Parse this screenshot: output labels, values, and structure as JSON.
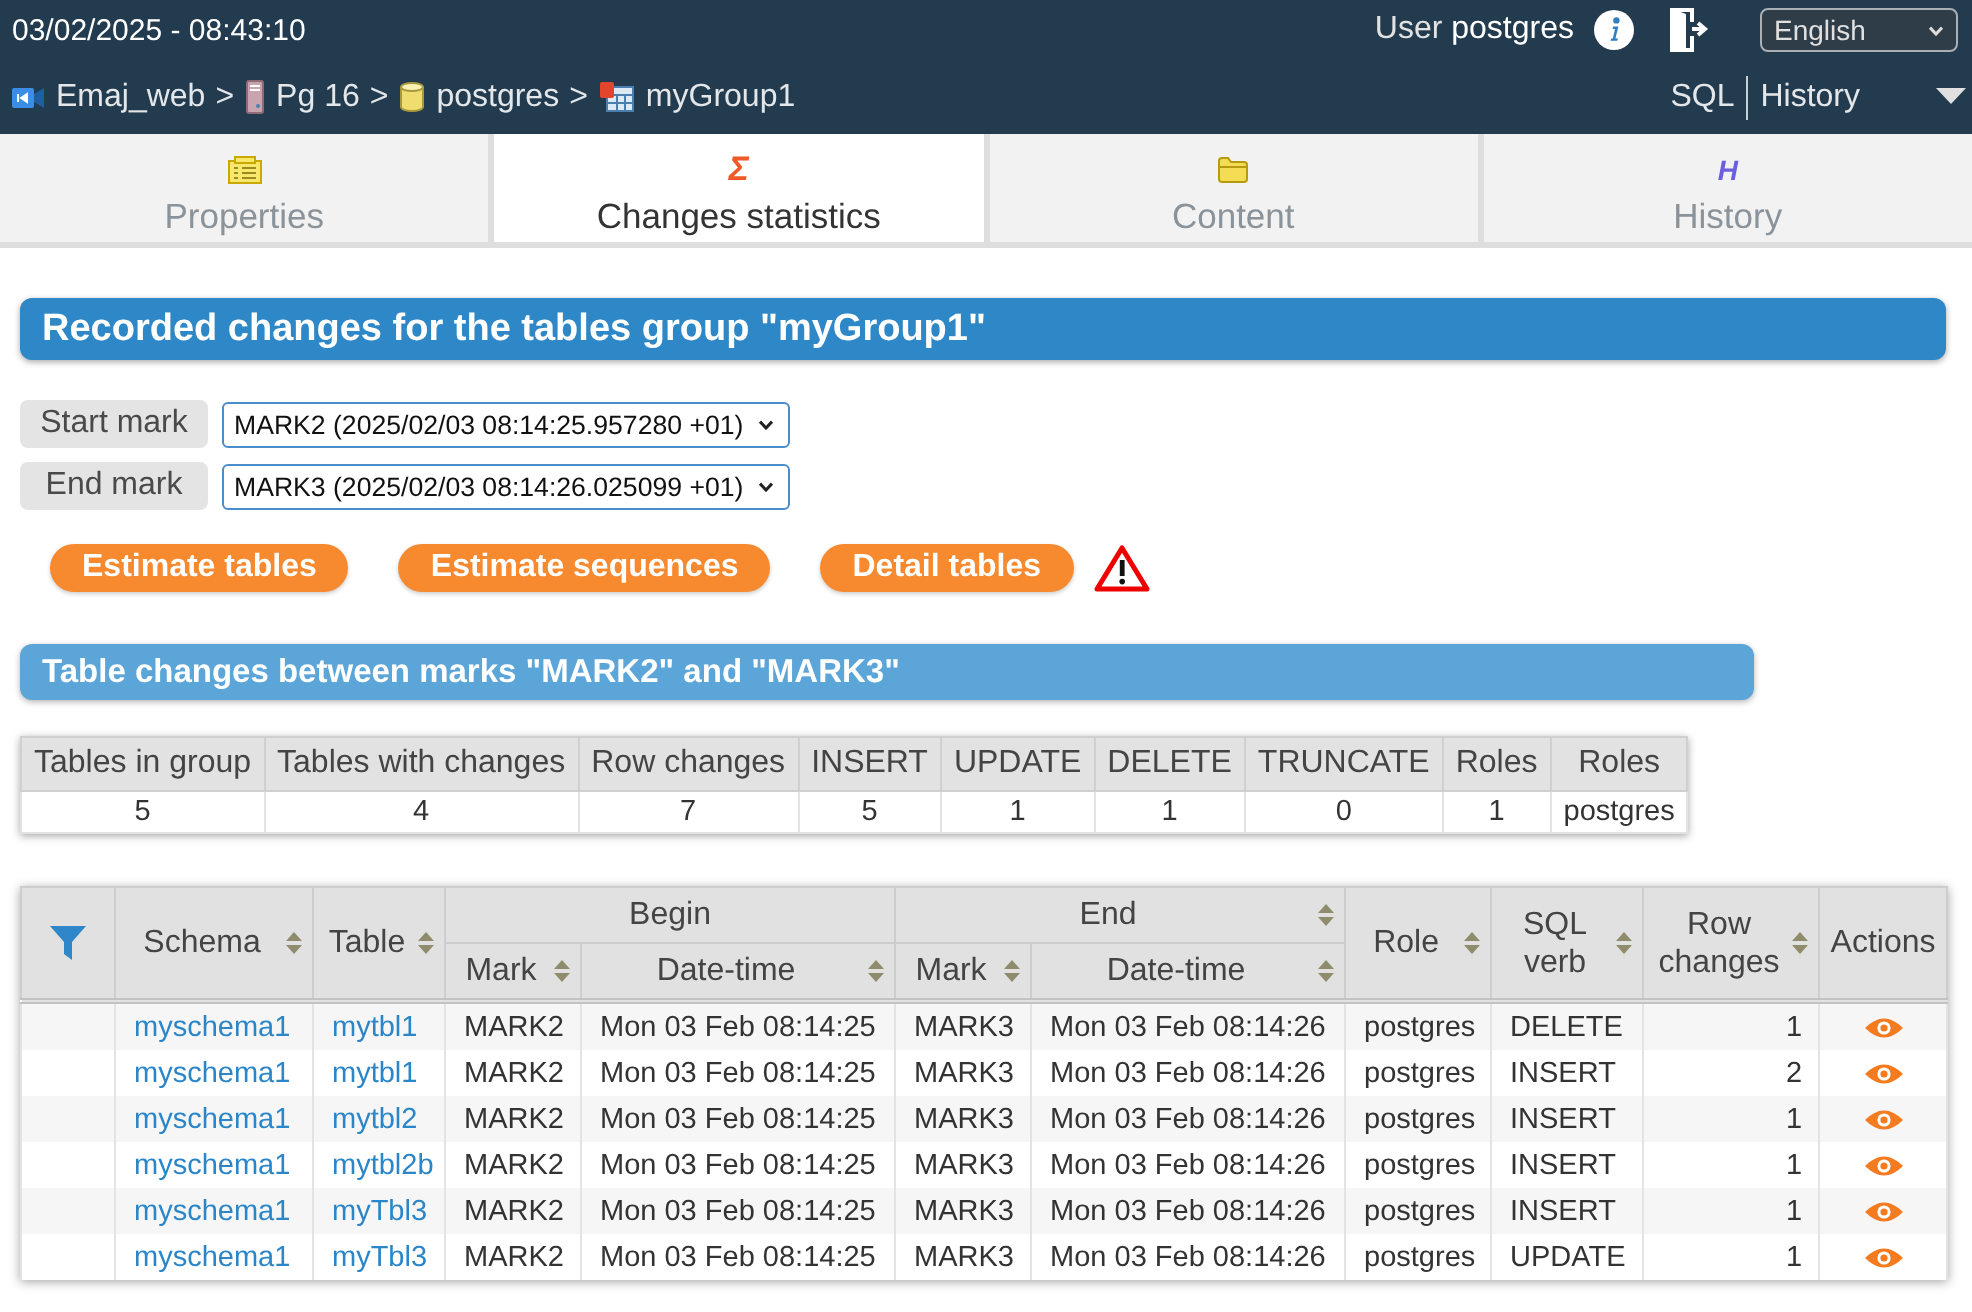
{
  "header": {
    "datetime": "03/02/2025 - 08:43:10",
    "user_label": "User",
    "user_name": "postgres",
    "language": "English"
  },
  "breadcrumbs": [
    {
      "kind": "app",
      "label": "Emaj_web",
      "separator": ">"
    },
    {
      "kind": "server",
      "label": "Pg 16",
      "separator": ">"
    },
    {
      "kind": "database",
      "label": "postgres",
      "separator": ">"
    },
    {
      "kind": "group",
      "label": "myGroup1"
    }
  ],
  "top_links": [
    "SQL",
    "History"
  ],
  "tabs": [
    {
      "kind": "properties",
      "label": "Properties",
      "selected": false
    },
    {
      "kind": "statistics",
      "glyph": "Σ",
      "label": "Changes statistics",
      "selected": true
    },
    {
      "kind": "content",
      "label": "Content",
      "selected": false
    },
    {
      "kind": "history",
      "glyph": "H",
      "label": "History",
      "selected": false
    }
  ],
  "page_title": "Recorded changes for the tables group \"myGroup1\"",
  "mark_selectors": [
    {
      "label": "Start mark",
      "value": "MARK2 (2025/02/03 08:14:25.957280 +01)"
    },
    {
      "label": "End mark",
      "value": "MARK3 (2025/02/03 08:14:26.025099 +01)"
    }
  ],
  "buttons": [
    "Estimate tables",
    "Estimate sequences",
    "Detail tables"
  ],
  "section_title": "Table changes between marks \"MARK2\" and \"MARK3\"",
  "summary": {
    "columns": [
      "Tables in group",
      "Tables with changes",
      "Row changes",
      "INSERT",
      "UPDATE",
      "DELETE",
      "TRUNCATE",
      "Roles",
      "Roles"
    ],
    "values": [
      "5",
      "4",
      "7",
      "5",
      "1",
      "1",
      "0",
      "1",
      "postgres"
    ]
  },
  "changes_table": {
    "columns": [
      {
        "label": "Schema",
        "sortable": true
      },
      {
        "label": "Table",
        "sortable": true
      },
      {
        "label": "Begin",
        "sortable": false,
        "children": [
          {
            "label": "Mark",
            "sortable": true
          },
          {
            "label": "Date-time",
            "sortable": true
          }
        ]
      },
      {
        "label": "End",
        "sortable": true,
        "children": [
          {
            "label": "Mark",
            "sortable": true
          },
          {
            "label": "Date-time",
            "sortable": true
          }
        ]
      },
      {
        "label": "Role",
        "sortable": true
      },
      {
        "label": "SQL verb",
        "sortable": true
      },
      {
        "label": "Row changes",
        "sortable": true
      },
      {
        "label": "Actions",
        "sortable": false
      }
    ],
    "rows": [
      {
        "schema": "myschema1",
        "table": "mytbl1",
        "begin_mark": "MARK2",
        "begin_time": "Mon 03 Feb 08:14:25",
        "end_mark": "MARK3",
        "end_time": "Mon 03 Feb 08:14:26",
        "role": "postgres",
        "verb": "DELETE",
        "changes": "1"
      },
      {
        "schema": "myschema1",
        "table": "mytbl1",
        "begin_mark": "MARK2",
        "begin_time": "Mon 03 Feb 08:14:25",
        "end_mark": "MARK3",
        "end_time": "Mon 03 Feb 08:14:26",
        "role": "postgres",
        "verb": "INSERT",
        "changes": "2"
      },
      {
        "schema": "myschema1",
        "table": "mytbl2",
        "begin_mark": "MARK2",
        "begin_time": "Mon 03 Feb 08:14:25",
        "end_mark": "MARK3",
        "end_time": "Mon 03 Feb 08:14:26",
        "role": "postgres",
        "verb": "INSERT",
        "changes": "1"
      },
      {
        "schema": "myschema1",
        "table": "mytbl2b",
        "begin_mark": "MARK2",
        "begin_time": "Mon 03 Feb 08:14:25",
        "end_mark": "MARK3",
        "end_time": "Mon 03 Feb 08:14:26",
        "role": "postgres",
        "verb": "INSERT",
        "changes": "1"
      },
      {
        "schema": "myschema1",
        "table": "myTbl3",
        "begin_mark": "MARK2",
        "begin_time": "Mon 03 Feb 08:14:25",
        "end_mark": "MARK3",
        "end_time": "Mon 03 Feb 08:14:26",
        "role": "postgres",
        "verb": "INSERT",
        "changes": "1"
      },
      {
        "schema": "myschema1",
        "table": "myTbl3",
        "begin_mark": "MARK2",
        "begin_time": "Mon 03 Feb 08:14:25",
        "end_mark": "MARK3",
        "end_time": "Mon 03 Feb 08:14:26",
        "role": "postgres",
        "verb": "UPDATE",
        "changes": "1"
      }
    ]
  }
}
